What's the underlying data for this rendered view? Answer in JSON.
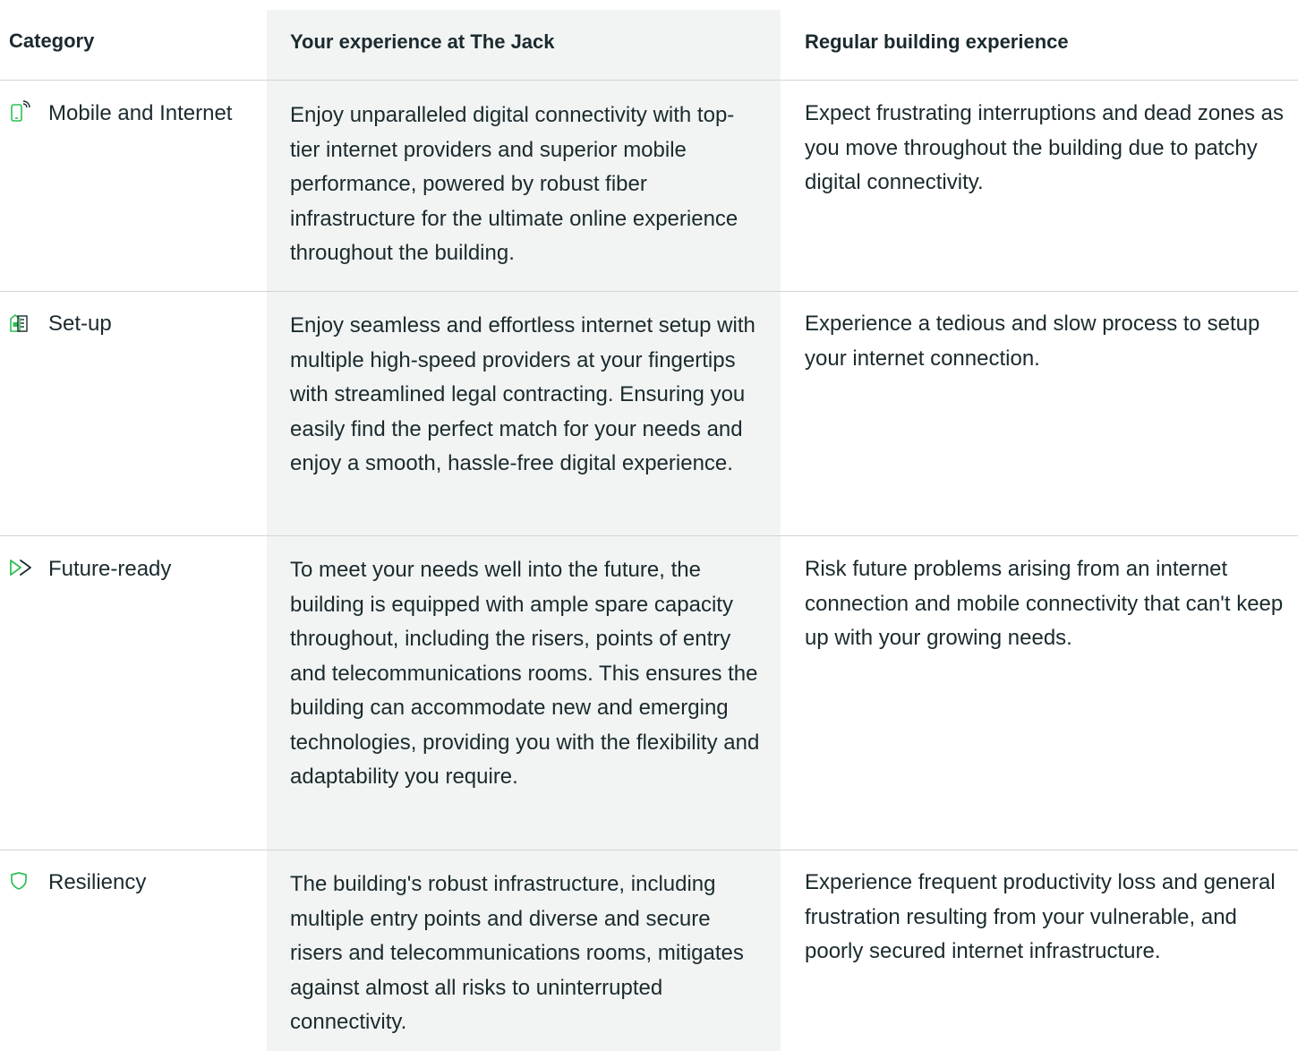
{
  "header": {
    "category": "Category",
    "jack": "Your experience at The Jack",
    "regular": "Regular building experience"
  },
  "accent_color": "#2fbf55",
  "rows": [
    {
      "icon": "mobile-icon",
      "category": "Mobile and Internet",
      "jack": "Enjoy unparalleled digital connectivity with top-tier internet providers and superior mobile performance, powered by robust fiber infrastructure for the ultimate online experience throughout the building.",
      "regular": "Expect frustrating interruptions and dead zones as you move throughout the building due to patchy digital connectivity."
    },
    {
      "icon": "building-setup-icon",
      "category": "Set-up",
      "jack": "Enjoy seamless and effortless internet setup with multiple high-speed providers at your fingertips with streamlined legal contracting. Ensuring you easily find the perfect match for your needs and enjoy a smooth, hassle-free digital experience.",
      "regular": "Experience a tedious and slow process to setup your internet connection."
    },
    {
      "icon": "fast-forward-icon",
      "category": "Future-ready",
      "jack": "To meet your needs well into the future, the building is equipped with ample spare capacity throughout, including the risers, points of entry and telecommunications rooms. This ensures the building can accommodate new and emerging technologies, providing you with the flexibility and adaptability you require.",
      "regular": "Risk future problems arising from an internet connection and mobile connectivity that can't keep up with your growing needs."
    },
    {
      "icon": "shield-icon",
      "category": "Resiliency",
      "jack": "The building's robust infrastructure, including multiple entry points and diverse and secure risers and telecommunications rooms, mitigates against almost all risks to uninterrupted connectivity.",
      "regular": "Experience frequent productivity loss and general frustration resulting from your vulnerable, and poorly secured internet infrastructure."
    }
  ]
}
